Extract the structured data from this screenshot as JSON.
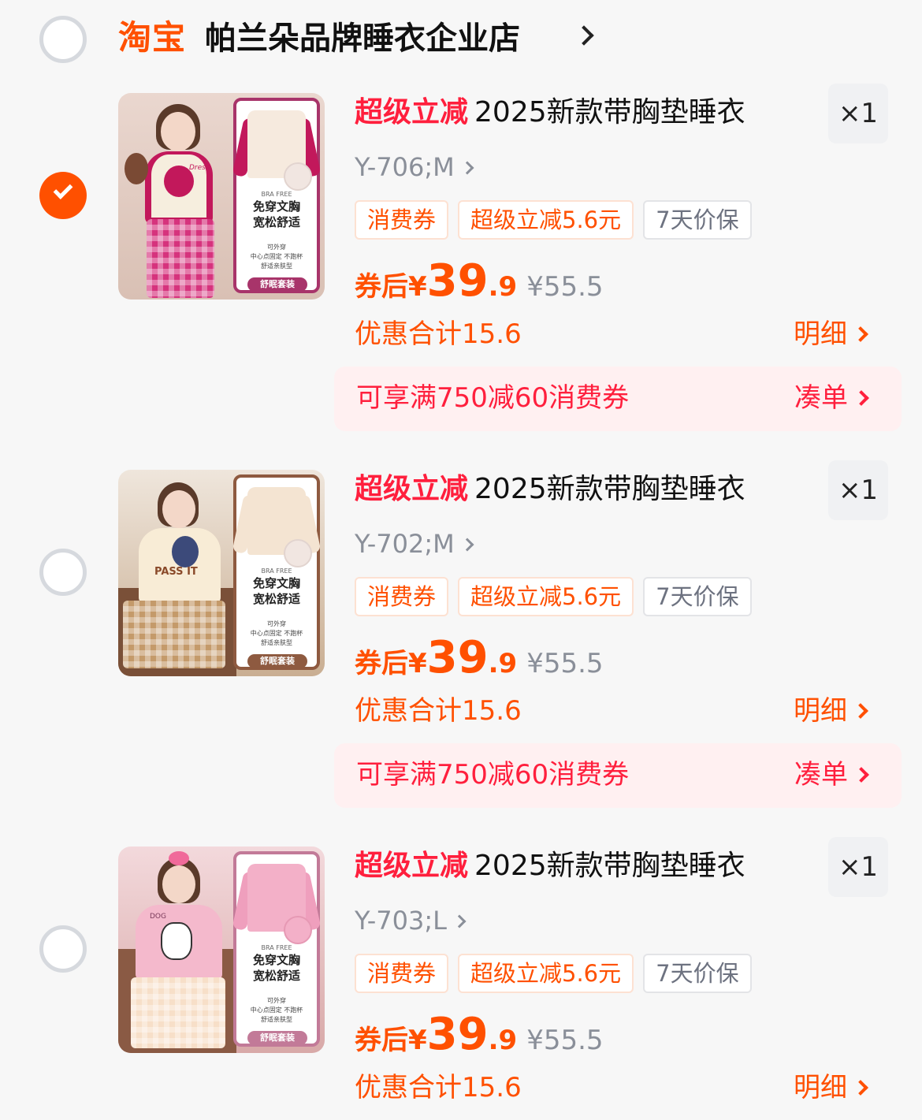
{
  "store": {
    "logo": "淘宝",
    "name": "帕兰朵品牌睡衣企业店"
  },
  "items": [
    {
      "selected": true,
      "promo": "超级立减",
      "title": "2025新款带胸垫睡衣",
      "qty": "×1",
      "sku": "Y-706;M",
      "tags": [
        "消费券",
        "超级立减5.6元",
        "7天价保"
      ],
      "price_label": "券后",
      "price_yen": "¥",
      "price_int": "39",
      "price_dec": ".9",
      "orig_price": "¥55.5",
      "discount": "优惠合计15.6",
      "detail": "明细",
      "coupon": "可享满750减60消费券",
      "coupon_action": "凑单",
      "thumb": {
        "bra": "BRA FREE",
        "l1": "免穿文胸",
        "l2": "宽松舒适",
        "s1": "可外穿",
        "s2": "中心点固定 不跑杯",
        "s3": "舒适亲肤型",
        "tag": "舒眠套装",
        "dress": "Dress"
      }
    },
    {
      "selected": false,
      "promo": "超级立减",
      "title": "2025新款带胸垫睡衣",
      "qty": "×1",
      "sku": "Y-702;M",
      "tags": [
        "消费券",
        "超级立减5.6元",
        "7天价保"
      ],
      "price_label": "券后",
      "price_yen": "¥",
      "price_int": "39",
      "price_dec": ".9",
      "orig_price": "¥55.5",
      "discount": "优惠合计15.6",
      "detail": "明细",
      "coupon": "可享满750减60消费券",
      "coupon_action": "凑单",
      "thumb": {
        "bra": "BRA FREE",
        "l1": "免穿文胸",
        "l2": "宽松舒适",
        "s1": "可外穿",
        "s2": "中心点固定 不跑杯",
        "s3": "舒适亲肤型",
        "tag": "舒眠套装",
        "dress": "PASS IT"
      }
    },
    {
      "selected": false,
      "promo": "超级立减",
      "title": "2025新款带胸垫睡衣",
      "qty": "×1",
      "sku": "Y-703;L",
      "tags": [
        "消费券",
        "超级立减5.6元",
        "7天价保"
      ],
      "price_label": "券后",
      "price_yen": "¥",
      "price_int": "39",
      "price_dec": ".9",
      "orig_price": "¥55.5",
      "discount": "优惠合计15.6",
      "detail": "明细",
      "thumb": {
        "bra": "BRA FREE",
        "l1": "免穿文胸",
        "l2": "宽松舒适",
        "s1": "可外穿",
        "s2": "中心点固定 不跑杯",
        "s3": "舒适亲肤型",
        "tag": "舒眠套装",
        "dress": "DOG"
      }
    }
  ],
  "colors": {
    "accent": "#ff5000",
    "promo_red": "#ff1f3d",
    "gray_text": "#8a8f99"
  }
}
